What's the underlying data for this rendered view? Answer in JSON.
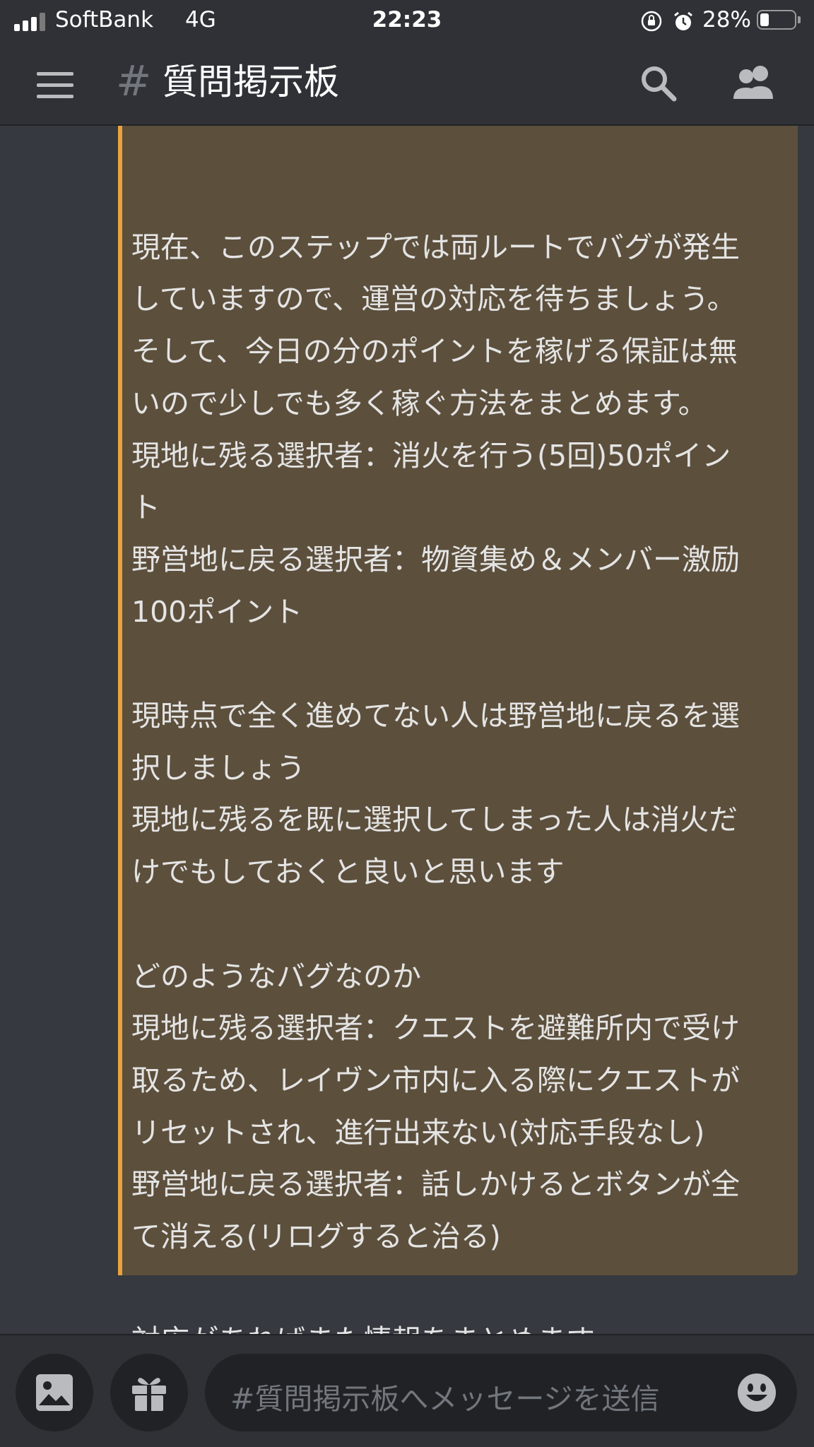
{
  "status_bar": {
    "carrier": "SoftBank",
    "network": "4G",
    "time": "22:23",
    "battery_percent": "28%",
    "battery_level": 0.28,
    "signal_bars": 3
  },
  "header": {
    "channel_prefix": "#",
    "channel_name": "質問掲示板",
    "menu_icon": "hamburger-menu-icon",
    "search_icon": "search-icon",
    "members_icon": "members-icon"
  },
  "message": {
    "accent_color": "#e8a33d",
    "background_color": "#5c4f3c",
    "lines": [
      "",
      "現在、このステップでは両ルートでバグが発生",
      "していますので、運営の対応を待ちましょう。",
      "そして、今日の分のポイントを稼げる保証は無",
      "いので少しでも多く稼ぐ方法をまとめます。",
      "現地に残る選択者：消火を行う(5回)50ポイン",
      "ト",
      "野営地に戻る選択者：物資集め＆メンバー激励",
      "100ポイント",
      "",
      "現時点で全く進めてない人は野営地に戻るを選",
      "択しましょう",
      "現地に残るを既に選択してしまった人は消火だ",
      "けでもしておくと良いと思います",
      "",
      "どのようなバグなのか",
      "現地に残る選択者：クエストを避難所内で受け",
      "取るため、レイヴン市内に入る際にクエストが",
      "リセットされ、進行出来ない(対応手段なし)",
      "野営地に戻る選択者：話しかけるとボタンが全",
      "て消える(リログすると治る)",
      "",
      "対応があればまた情報をまとめます"
    ]
  },
  "composer": {
    "placeholder": "#質問掲示板へメッセージを送信",
    "image_icon": "image-icon",
    "gift_icon": "gift-icon",
    "emoji_icon": "emoji-icon"
  }
}
